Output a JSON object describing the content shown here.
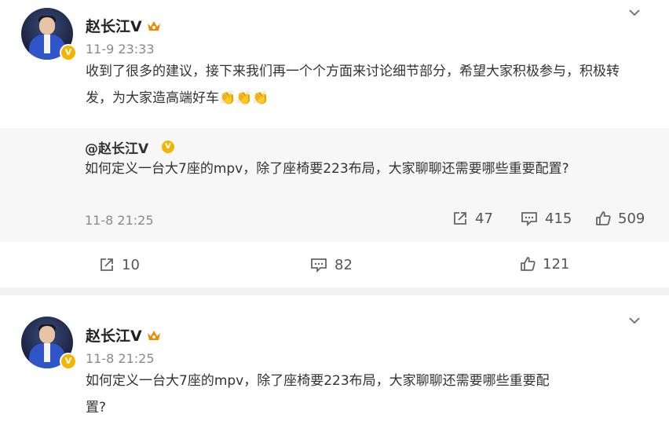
{
  "post1": {
    "author": "赵长江V",
    "verified_badge": "V",
    "time": "11-9 23:33",
    "text": "收到了很多的建议，接下来我们再一个个方面来讨论细节部分，希望大家积极参与，积极转发，为大家造高端好车👏👏👏",
    "quote": {
      "author": "@赵长江V",
      "verified_badge": "V",
      "text": "如何定义一台大7座的mpv，除了座椅要223布局，大家聊聊还需要哪些重要配置?",
      "time": "11-8 21:25",
      "stats": {
        "reposts": "47",
        "comments": "415",
        "likes": "509"
      }
    },
    "stats": {
      "reposts": "10",
      "comments": "82",
      "likes": "121"
    }
  },
  "post2": {
    "author": "赵长江V",
    "verified_badge": "V",
    "time": "11-8 21:25",
    "text": "如何定义一台大7座的mpv，除了座椅要223布局，大家聊聊还需要哪些重要配置?"
  },
  "icons": {
    "repost": "share-icon",
    "comment": "comment-icon",
    "like": "thumbs-up-icon",
    "more": "chevron-down-icon",
    "member": "crown-icon"
  },
  "colors": {
    "badge": "#f6b400",
    "member": "#f08a00",
    "text": "#333333",
    "meta": "#8a8a8a"
  }
}
